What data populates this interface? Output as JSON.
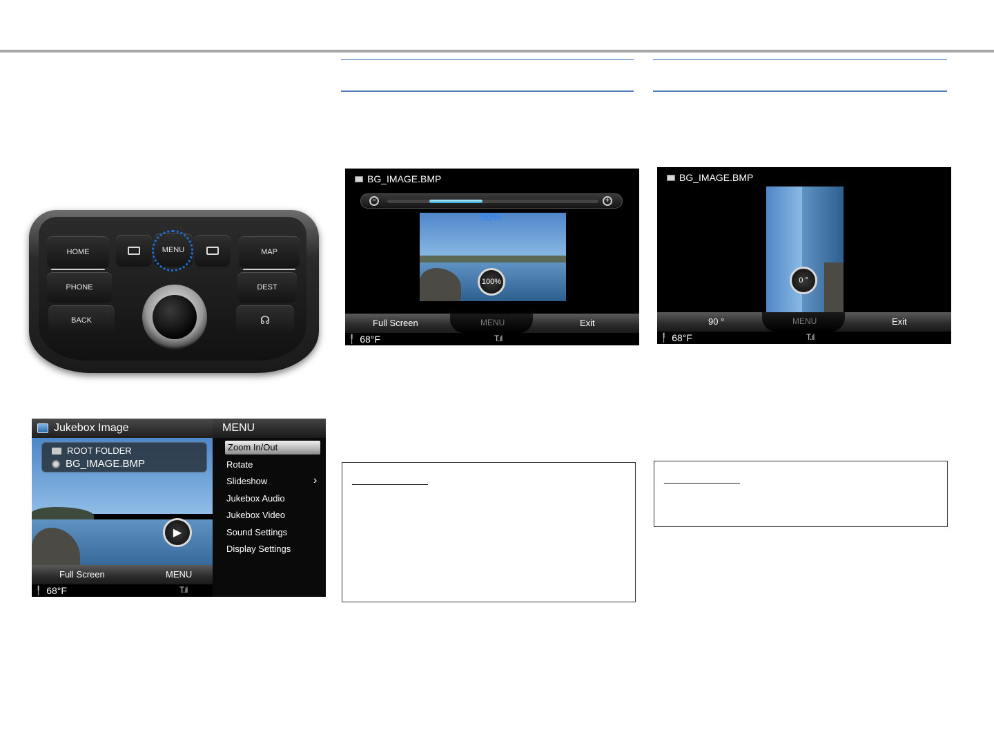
{
  "control_panel": {
    "home": "HOME",
    "menu": "MENU",
    "map": "MAP",
    "phone": "PHONE",
    "dest": "DEST",
    "back": "BACK"
  },
  "jukebox_screen": {
    "title": "Jukebox Image",
    "menu_title": "MENU",
    "folder": "ROOT FOLDER",
    "file": "BG_IMAGE.BMP",
    "menu_items": [
      "Zoom In/Out",
      "Rotate",
      "Slideshow",
      "Jukebox Audio",
      "Jukebox Video",
      "Sound Settings",
      "Display Settings"
    ],
    "slideshow_arrow": "›",
    "softkey_left": "Full Screen",
    "softkey_menu": "MENU",
    "temperature": "68°F",
    "signal": "T.ıl"
  },
  "zoom_screen": {
    "file": "BG_IMAGE.BMP",
    "zoom_percent": "50%",
    "zoom_level": 0.25,
    "badge": "100%",
    "zoom_out_glyph": "−",
    "zoom_in_glyph": "+",
    "softkey_left": "Full Screen",
    "softkey_menu": "MENU",
    "softkey_right": "Exit",
    "temperature": "68°F",
    "signal": "T.ıl"
  },
  "rotate_screen": {
    "file": "BG_IMAGE.BMP",
    "badge": "0 °",
    "softkey_left": "90 °",
    "softkey_menu": "MENU",
    "softkey_right": "Exit",
    "temperature": "68°F",
    "signal": "T.ıl"
  },
  "colors": {
    "section_rule": "#4f80bd",
    "zoom_percent": "#2c82ff",
    "menu_highlight_ring": "#1f6fd6"
  }
}
